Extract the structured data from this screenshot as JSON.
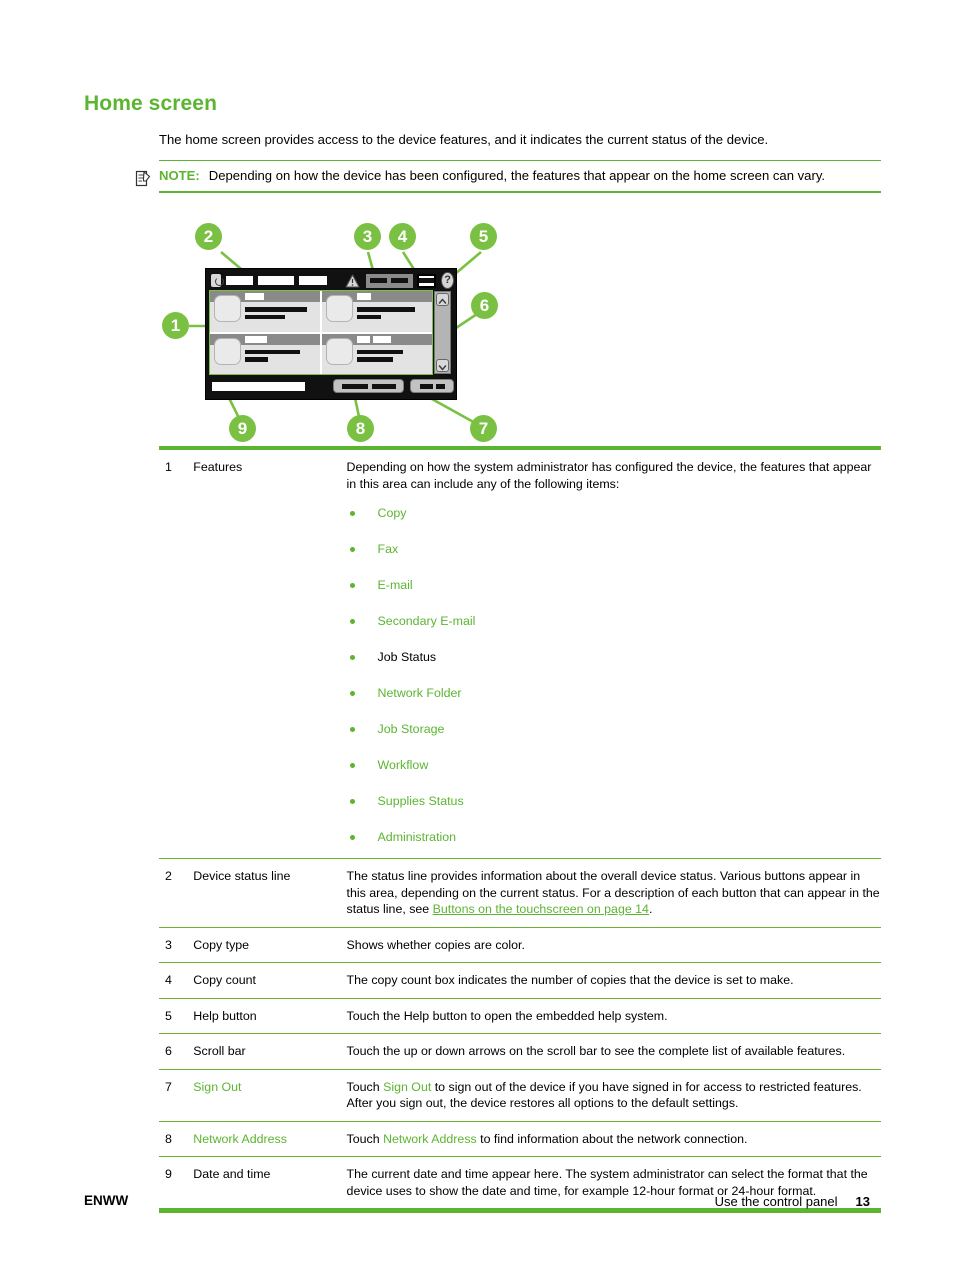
{
  "heading": "Home screen",
  "intro": "The home screen provides access to the device features, and it indicates the current status of the device.",
  "note": {
    "icon": "note-pencil-icon",
    "label": "NOTE:",
    "text": "Depending on how the device has been configured, the features that appear on the home screen can vary."
  },
  "figure": {
    "name": "home-screen-callout-diagram",
    "accent_color": "#7AC143",
    "callouts": [
      {
        "number": "1",
        "target": "features-area"
      },
      {
        "number": "2",
        "target": "device-status-line"
      },
      {
        "number": "3",
        "target": "copy-type"
      },
      {
        "number": "4",
        "target": "copy-count"
      },
      {
        "number": "5",
        "target": "help-button"
      },
      {
        "number": "6",
        "target": "scroll-bar"
      },
      {
        "number": "7",
        "target": "sign-out-button"
      },
      {
        "number": "8",
        "target": "network-address-button"
      },
      {
        "number": "9",
        "target": "date-and-time"
      }
    ]
  },
  "table": {
    "rows": [
      {
        "num": "1",
        "name": "Features",
        "name_link": false,
        "desc": "Depending on how the system administrator has configured the device, the features that appear in this area can include any of the following items:",
        "features": [
          {
            "label": "Copy",
            "link": true
          },
          {
            "label": "Fax",
            "link": true
          },
          {
            "label": "E-mail",
            "link": true
          },
          {
            "label": "Secondary E-mail",
            "link": true
          },
          {
            "label": "Job Status",
            "link": false
          },
          {
            "label": "Network Folder",
            "link": true
          },
          {
            "label": "Job Storage",
            "link": true
          },
          {
            "label": "Workflow",
            "link": true
          },
          {
            "label": "Supplies Status",
            "link": true
          },
          {
            "label": "Administration",
            "link": true
          }
        ]
      },
      {
        "num": "2",
        "name": "Device status line",
        "name_link": false,
        "desc_pre": "The status line provides information about the overall device status. Various buttons appear in this area, depending on the current status. For a description of each button that can appear in the status line, see ",
        "xref": "Buttons on the touchscreen on page 14",
        "desc_post": "."
      },
      {
        "num": "3",
        "name": "Copy type",
        "name_link": false,
        "desc": "Shows whether copies are color."
      },
      {
        "num": "4",
        "name": "Copy count",
        "name_link": false,
        "desc": "The copy count box indicates the number of copies that the device is set to make."
      },
      {
        "num": "5",
        "name": "Help button",
        "name_link": false,
        "desc": "Touch the Help button to open the embedded help system."
      },
      {
        "num": "6",
        "name": "Scroll bar",
        "name_link": false,
        "desc": "Touch the up or down arrows on the scroll bar to see the complete list of available features."
      },
      {
        "num": "7",
        "name": "Sign Out",
        "name_link": true,
        "desc_pre": "Touch ",
        "inline_link": "Sign Out",
        "desc_post": " to sign out of the device if you have signed in for access to restricted features. After you sign out, the device restores all options to the default settings."
      },
      {
        "num": "8",
        "name": "Network Address",
        "name_link": true,
        "desc_pre": "Touch ",
        "inline_link": "Network Address",
        "desc_post": " to find information about the network connection."
      },
      {
        "num": "9",
        "name": "Date and time",
        "name_link": false,
        "desc": "The current date and time appear here. The system administrator can select the format that the device uses to show the date and time, for example 12-hour format or 24-hour format."
      }
    ]
  },
  "footer": {
    "left": "ENWW",
    "section": "Use the control panel",
    "page": "13"
  }
}
